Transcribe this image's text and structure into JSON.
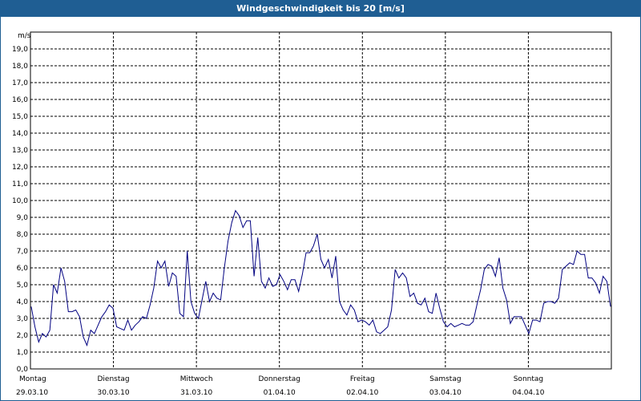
{
  "window": {
    "title": "Windgeschwindigkeit bis 20 [m/s]"
  },
  "chart_data": {
    "type": "line",
    "title": "Windgeschwindigkeit bis 20 [m/s]",
    "ylabel": "m/s",
    "ylim": [
      0,
      20
    ],
    "grid": true,
    "y_ticks": [
      "0,0",
      "1,0",
      "2,0",
      "3,0",
      "4,0",
      "5,0",
      "6,0",
      "7,0",
      "8,0",
      "9,0",
      "10,0",
      "11,0",
      "12,0",
      "13,0",
      "14,0",
      "15,0",
      "16,0",
      "17,0",
      "18,0",
      "19,0"
    ],
    "x_categories": [
      {
        "day": "Montag",
        "date": "29.03.10"
      },
      {
        "day": "Dienstag",
        "date": "30.03.10"
      },
      {
        "day": "Mittwoch",
        "date": "31.03.10"
      },
      {
        "day": "Donnerstag",
        "date": "01.04.10"
      },
      {
        "day": "Freitag",
        "date": "02.04.10"
      },
      {
        "day": "Samstag",
        "date": "03.04.10"
      },
      {
        "day": "Sonntag",
        "date": "04.04.10"
      }
    ],
    "colors": {
      "line": "#000080",
      "grid": "#000000",
      "title_bar": "#1f5e93"
    },
    "series": [
      {
        "values": [
          3.7,
          2.5,
          1.6,
          2.1,
          1.9,
          2.3,
          5.0,
          4.5,
          6.0,
          5.2,
          3.4,
          3.4,
          3.5,
          3.1,
          1.9,
          1.4,
          2.3,
          2.1,
          2.6,
          3.1,
          3.4,
          3.8,
          3.6,
          2.5,
          2.4,
          2.3,
          2.9,
          2.3,
          2.6,
          2.8,
          3.1,
          3.0,
          3.8,
          4.8,
          6.4,
          6.0,
          6.4,
          4.9,
          5.7,
          5.5,
          3.3,
          3.1,
          7.0,
          4.0,
          3.3,
          3.0,
          4.1,
          5.2,
          4.0,
          4.5,
          4.2,
          4.1,
          6.0,
          7.6,
          8.7,
          9.4,
          9.1,
          8.4,
          8.8,
          8.8,
          5.5,
          7.8,
          5.2,
          4.8,
          5.4,
          4.9,
          5.0,
          5.6,
          5.2,
          4.7,
          5.3,
          5.3,
          4.6,
          5.6,
          6.9,
          6.9,
          7.3,
          8.0,
          6.5,
          6.0,
          6.5,
          5.4,
          6.7,
          4.0,
          3.5,
          3.2,
          3.8,
          3.5,
          2.8,
          2.9,
          2.8,
          2.6,
          2.9,
          2.2,
          2.1,
          2.3,
          2.5,
          3.5,
          5.9,
          5.4,
          5.7,
          5.4,
          4.3,
          4.5,
          3.9,
          3.8,
          4.2,
          3.4,
          3.3,
          4.5,
          3.6,
          2.8,
          2.5,
          2.7,
          2.5,
          2.6,
          2.7,
          2.6,
          2.6,
          2.8,
          3.8,
          4.7,
          5.9,
          6.2,
          6.1,
          5.5,
          6.6,
          4.8,
          4.1,
          2.7,
          3.1,
          3.1,
          3.1,
          2.6,
          2.1,
          2.9,
          2.9,
          2.8,
          3.9,
          4.0,
          4.0,
          3.9,
          4.2,
          5.9,
          6.1,
          6.3,
          6.2,
          7.0,
          6.8,
          6.8,
          5.4,
          5.4,
          5.1,
          4.5,
          5.5,
          5.2,
          3.7
        ]
      }
    ]
  }
}
